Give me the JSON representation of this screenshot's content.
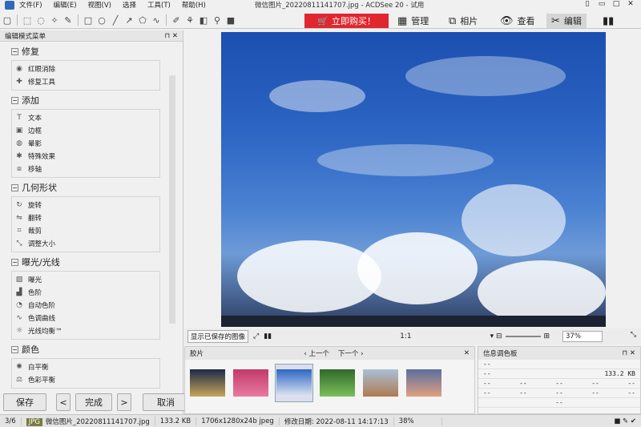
{
  "menu": {
    "items": [
      "文件(F)",
      "编辑(E)",
      "视图(V)",
      "选择",
      "工具(T)",
      "帮助(H)"
    ]
  },
  "window": {
    "title": "微信图片_20220811141707.jpg - ACDSee 20 - 试用"
  },
  "buy": {
    "label": "立即购买！"
  },
  "modes": {
    "manage": "管理",
    "photos": "相片",
    "view": "查看",
    "edit": "编辑"
  },
  "left_panel": {
    "title": "编辑模式菜单",
    "sections": [
      {
        "title": "修复",
        "items": [
          {
            "label": "红眼消除",
            "icon": "redeye-icon"
          },
          {
            "label": "修复工具",
            "icon": "repair-icon"
          }
        ]
      },
      {
        "title": "添加",
        "items": [
          {
            "label": "文本",
            "icon": "text-icon"
          },
          {
            "label": "边框",
            "icon": "border-icon"
          },
          {
            "label": "晕影",
            "icon": "vignette-icon"
          },
          {
            "label": "特殊效果",
            "icon": "effects-icon"
          },
          {
            "label": "移轴",
            "icon": "tiltshift-icon"
          }
        ]
      },
      {
        "title": "几何形状",
        "items": [
          {
            "label": "旋转",
            "icon": "rotate-icon"
          },
          {
            "label": "翻转",
            "icon": "flip-icon"
          },
          {
            "label": "裁剪",
            "icon": "crop-icon"
          },
          {
            "label": "调整大小",
            "icon": "resize-icon"
          }
        ]
      },
      {
        "title": "曝光/光线",
        "items": [
          {
            "label": "曝光",
            "icon": "exposure-icon"
          },
          {
            "label": "色阶",
            "icon": "levels-icon"
          },
          {
            "label": "自动色阶",
            "icon": "autolevels-icon"
          },
          {
            "label": "色调曲线",
            "icon": "curves-icon"
          },
          {
            "label": "光线均衡™",
            "icon": "lighting-icon"
          }
        ]
      },
      {
        "title": "颜色",
        "items": [
          {
            "label": "白平衡",
            "icon": "whitebalance-icon"
          },
          {
            "label": "色彩平衡",
            "icon": "colorbalance-icon"
          }
        ]
      }
    ]
  },
  "buttons": {
    "save": "保存",
    "prev": "<",
    "done": "完成",
    "next": ">",
    "cancel": "取消"
  },
  "viewer": {
    "show_saved": "显示已保存的图像",
    "ratio": "1:1",
    "zoom": "37%"
  },
  "filmstrip": {
    "title": "胶片",
    "prev": "上一个",
    "next": "下一个",
    "selected_index": 2
  },
  "info": {
    "title": "信息调色板",
    "r1": "--",
    "r2_left": "--",
    "r2_right": "133.2 KB",
    "dash": "--"
  },
  "status": {
    "position": "3/6",
    "format": "JPG",
    "filename": "微信图片_20220811141707.jpg",
    "size": "133.2 KB",
    "dims": "1706x1280x24b jpeg",
    "modified": "修改日期: 2022-08-11 14:17:13",
    "zoom": "38%"
  }
}
